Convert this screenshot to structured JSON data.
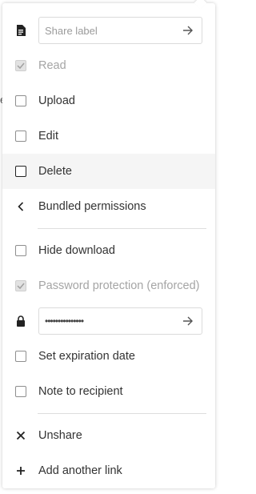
{
  "background_stub": "e",
  "share_label": {
    "placeholder": "Share label"
  },
  "permissions": {
    "read": {
      "label": "Read",
      "checked": true,
      "disabled": true
    },
    "upload": {
      "label": "Upload",
      "checked": false
    },
    "edit": {
      "label": "Edit",
      "checked": false
    },
    "delete": {
      "label": "Delete",
      "checked": false
    }
  },
  "bundled_permissions": {
    "label": "Bundled permissions"
  },
  "hide_download": {
    "label": "Hide download",
    "checked": false
  },
  "password_protection": {
    "label": "Password protection (enforced)",
    "checked": true,
    "disabled": true
  },
  "password": {
    "value": "•••••••••••••••"
  },
  "expiration": {
    "label": "Set expiration date",
    "checked": false
  },
  "note": {
    "label": "Note to recipient",
    "checked": false
  },
  "unshare": {
    "label": "Unshare"
  },
  "add_link": {
    "label": "Add another link"
  },
  "colors": {
    "hover_row": "#f5f5f5",
    "muted_text": "#a5a5a5",
    "separator": "#dedede"
  }
}
